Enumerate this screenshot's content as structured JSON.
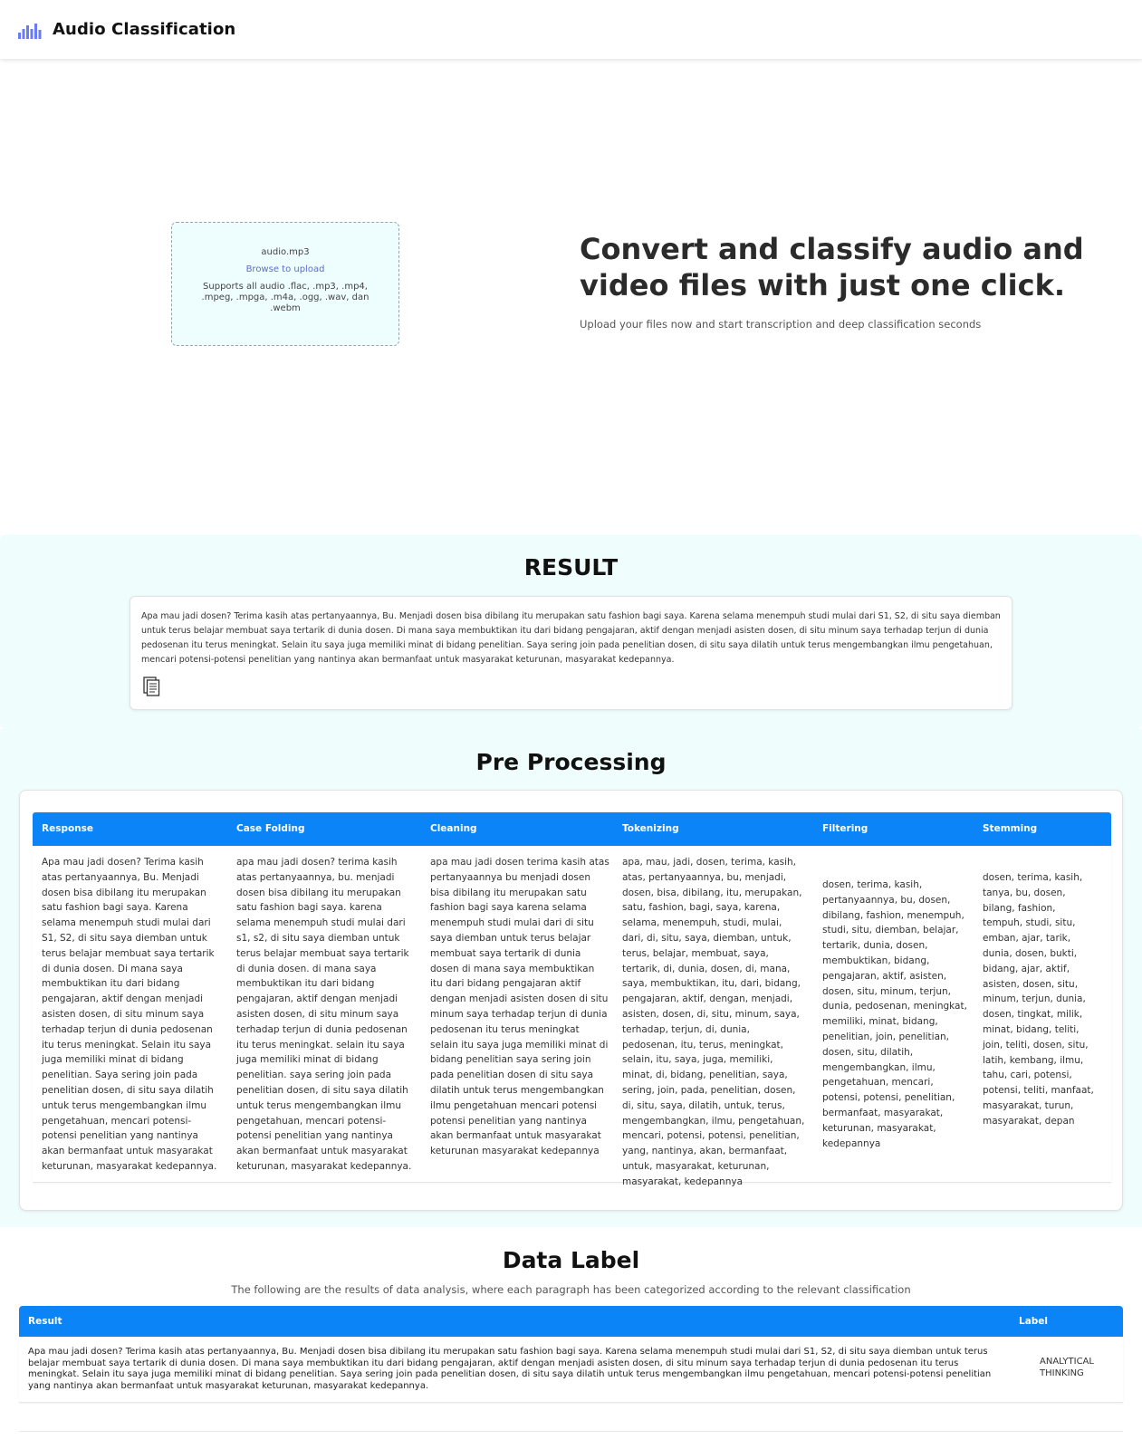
{
  "header": {
    "title": "Audio Classification",
    "logo_icon": "audio-bars-icon",
    "logo_color": "#6b7cf0"
  },
  "hero": {
    "upload": {
      "filename": "audio.mp3",
      "browse_label": "Browse to upload",
      "supported_formats": "Supports all audio .flac, .mp3, .mp4, .mpeg, .mpga, .m4a, .ogg, .wav, dan .webm"
    },
    "heading": "Convert and classify audio and video files with just one click.",
    "subheading": "Upload your files now and start transcription and deep classification seconds"
  },
  "result": {
    "title": "RESULT",
    "text": "Apa mau jadi dosen? Terima kasih atas pertanyaannya, Bu. Menjadi dosen bisa dibilang itu merupakan satu fashion bagi saya. Karena selama menempuh studi mulai dari S1, S2, di situ saya diemban untuk terus belajar membuat saya tertarik di dunia dosen. Di mana saya membuktikan itu dari bidang pengajaran, aktif dengan menjadi asisten dosen, di situ minum saya terhadap terjun di dunia pedosenan itu terus meningkat. Selain itu saya juga memiliki minat di bidang penelitian. Saya sering join pada penelitian dosen, di situ saya dilatih untuk terus mengembangkan ilmu pengetahuan, mencari potensi-potensi penelitian yang nantinya akan bermanfaat untuk masyarakat keturunan, masyarakat kedepannya.",
    "copy_icon": "copy-icon"
  },
  "preprocessing": {
    "title": "Pre Processing",
    "columns": [
      "Response",
      "Case Folding",
      "Cleaning",
      "Tokenizing",
      "Filtering",
      "Stemming"
    ],
    "rows": [
      {
        "response": "Apa mau jadi dosen? Terima kasih atas pertanyaannya, Bu. Menjadi dosen bisa dibilang itu merupakan satu fashion bagi saya. Karena selama menempuh studi mulai dari S1, S2, di situ saya diemban untuk terus belajar membuat saya tertarik di dunia dosen. Di mana saya membuktikan itu dari bidang pengajaran, aktif dengan menjadi asisten dosen, di situ minum saya terhadap terjun di dunia pedosenan itu terus meningkat. Selain itu saya juga memiliki minat di bidang penelitian. Saya sering join pada penelitian dosen, di situ saya dilatih untuk terus mengembangkan ilmu pengetahuan, mencari potensi-potensi penelitian yang nantinya akan bermanfaat untuk masyarakat keturunan, masyarakat kedepannya.",
        "case_folding": "apa mau jadi dosen? terima kasih atas pertanyaannya, bu. menjadi dosen bisa dibilang itu merupakan satu fashion bagi saya. karena selama menempuh studi mulai dari s1, s2, di situ saya diemban untuk terus belajar membuat saya tertarik di dunia dosen. di mana saya membuktikan itu dari bidang pengajaran, aktif dengan menjadi asisten dosen, di situ minum saya terhadap terjun di dunia pedosenan itu terus meningkat. selain itu saya juga memiliki minat di bidang penelitian. saya sering join pada penelitian dosen, di situ saya dilatih untuk terus mengembangkan ilmu pengetahuan, mencari potensi-potensi penelitian yang nantinya akan bermanfaat untuk masyarakat keturunan, masyarakat kedepannya.",
        "cleaning": "apa mau jadi dosen terima kasih atas pertanyaannya bu menjadi dosen bisa dibilang itu merupakan satu fashion bagi saya karena selama menempuh studi mulai dari di situ saya diemban untuk terus belajar membuat saya tertarik di dunia dosen di mana saya membuktikan itu dari bidang pengajaran aktif dengan menjadi asisten dosen di situ minum saya terhadap terjun di dunia pedosenan itu terus meningkat selain itu saya juga memiliki minat di bidang penelitian saya sering join pada penelitian dosen di situ saya dilatih untuk terus mengembangkan ilmu pengetahuan mencari potensi potensi penelitian yang nantinya akan bermanfaat untuk masyarakat keturunan masyarakat kedepannya",
        "tokenizing": "apa, mau, jadi, dosen, terima, kasih, atas, pertanyaannya, bu, menjadi, dosen, bisa, dibilang, itu, merupakan, satu, fashion, bagi, saya, karena, selama, menempuh, studi, mulai, dari, di, situ, saya, diemban, untuk, terus, belajar, membuat, saya, tertarik, di, dunia, dosen, di, mana, saya, membuktikan, itu, dari, bidang, pengajaran, aktif, dengan, menjadi, asisten, dosen, di, situ, minum, saya, terhadap, terjun, di, dunia, pedosenan, itu, terus, meningkat, selain, itu, saya, juga, memiliki, minat, di, bidang, penelitian, saya, sering, join, pada, penelitian, dosen, di, situ, saya, dilatih, untuk, terus, mengembangkan, ilmu, pengetahuan, mencari, potensi, potensi, penelitian, yang, nantinya, akan, bermanfaat, untuk, masyarakat, keturunan, masyarakat, kedepannya",
        "filtering": "dosen, terima, kasih, pertanyaannya, bu, dosen, dibilang, fashion, menempuh, studi, situ, diemban, belajar, tertarik, dunia, dosen, membuktikan, bidang, pengajaran, aktif, asisten, dosen, situ, minum, terjun, dunia, pedosenan, meningkat, memiliki, minat, bidang, penelitian, join, penelitian, dosen, situ, dilatih, mengembangkan, ilmu, pengetahuan, mencari, potensi, potensi, penelitian, bermanfaat, masyarakat, keturunan, masyarakat, kedepannya",
        "stemming": "dosen, terima, kasih, tanya, bu, dosen, bilang, fashion, tempuh, studi, situ, emban, ajar, tarik, dunia, dosen, bukti, bidang, ajar, aktif, asisten, dosen, situ, minum, terjun, dunia, dosen, tingkat, milik, minat, bidang, teliti, join, teliti, dosen, situ, latih, kembang, ilmu, tahu, cari, potensi, potensi, teliti, manfaat, masyarakat, turun, masyarakat, depan"
      }
    ]
  },
  "data_label": {
    "title": "Data Label",
    "subtitle": "The following are the results of data analysis, where each paragraph has been categorized according to the relevant classification",
    "columns": [
      "Result",
      "Label"
    ],
    "rows": [
      {
        "result": "Apa mau jadi dosen? Terima kasih atas pertanyaannya, Bu. Menjadi dosen bisa dibilang itu merupakan satu fashion bagi saya. Karena selama menempuh studi mulai dari S1, S2, di situ saya diemban untuk terus belajar membuat saya tertarik di dunia dosen. Di mana saya membuktikan itu dari bidang pengajaran, aktif dengan menjadi asisten dosen, di situ minum saya terhadap terjun di dunia pedosenan itu terus meningkat. Selain itu saya juga memiliki minat di bidang penelitian. Saya sering join pada penelitian dosen, di situ saya dilatih untuk terus mengembangkan ilmu pengetahuan, mencari potensi-potensi penelitian yang nantinya akan bermanfaat untuk masyarakat keturunan, masyarakat kedepannya.",
        "label": "ANALYTICAL THINKING"
      }
    ]
  },
  "colors": {
    "accent": "#0b84f8",
    "section_bg": "#f0fdfd",
    "upload_bg": "#eefdfe"
  }
}
